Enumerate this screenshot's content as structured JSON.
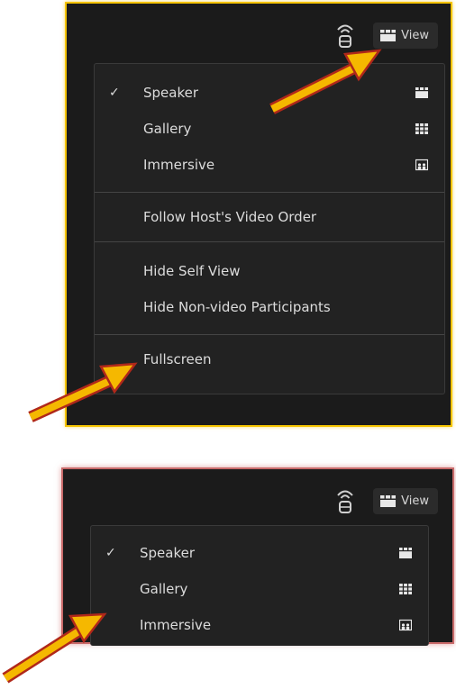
{
  "top_panel": {
    "view_button": {
      "label": "View"
    },
    "menu": {
      "layout_items": [
        {
          "label": "Speaker",
          "checked": "✓",
          "icon": "speaker-view-icon"
        },
        {
          "label": "Gallery",
          "checked": "",
          "icon": "gallery-grid-icon"
        },
        {
          "label": "Immersive",
          "checked": "",
          "icon": "immersive-scene-icon"
        }
      ],
      "follow_host": "Follow Host's Video Order",
      "hide_self_view": "Hide Self View",
      "hide_non_video": "Hide Non-video Participants",
      "fullscreen": "Fullscreen"
    }
  },
  "bottom_panel": {
    "view_button": {
      "label": "View"
    },
    "menu": {
      "layout_items": [
        {
          "label": "Speaker",
          "checked": "✓",
          "icon": "speaker-view-icon"
        },
        {
          "label": "Gallery",
          "checked": "",
          "icon": "gallery-grid-icon"
        },
        {
          "label": "Immersive",
          "checked": "",
          "icon": "immersive-scene-icon"
        }
      ]
    }
  },
  "colors": {
    "panel_bg": "#1b1b1b",
    "menu_bg": "#222222",
    "top_border": "#f5c400",
    "bottom_border": "#c86a6a",
    "arrow_fill": "#f5b800",
    "arrow_outline": "#b0281a"
  }
}
